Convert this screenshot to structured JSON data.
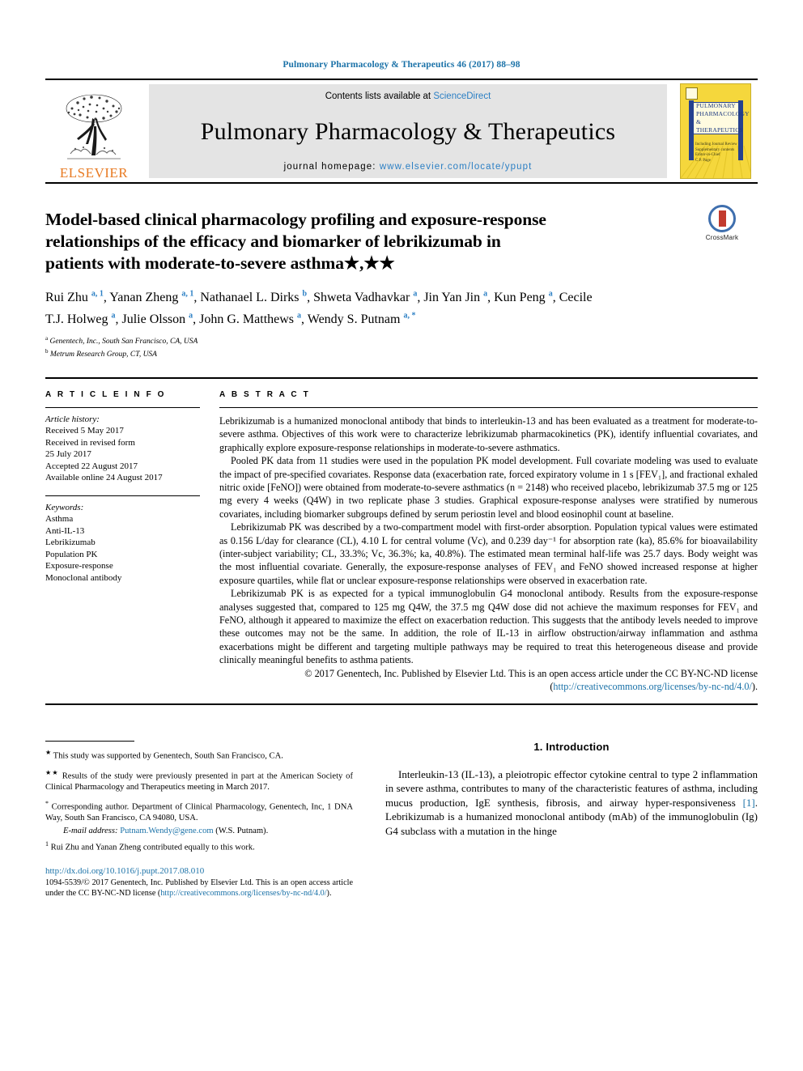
{
  "running_head": "Pulmonary Pharmacology & Therapeutics 46 (2017) 88–98",
  "masthead": {
    "contents_prefix": "Contents lists available at ",
    "sciencedirect": "ScienceDirect",
    "journal_name": "Pulmonary Pharmacology & Therapeutics",
    "homepage_prefix": "journal homepage: ",
    "homepage_url": "www.elsevier.com/locate/ypupt",
    "publisher": "ELSEVIER",
    "cover_title_lines": [
      "PULMONARY",
      "PHARMACOLOGY",
      "& THERAPEUTICS"
    ],
    "cover_sub_lines": [
      "Including Journal Review",
      "Supplementary contents",
      "Editor-in-Chief",
      "C.P. Page"
    ]
  },
  "article": {
    "title": "Model-based clinical pharmacology profiling and exposure-response relationships of the efficacy and biomarker of lebrikizumab in patients with moderate-to-severe asthma★,★★",
    "crossmark_label": "CrossMark",
    "authors": [
      {
        "name": "Rui Zhu",
        "marks": "a, 1"
      },
      {
        "name": "Yanan Zheng",
        "marks": "a, 1"
      },
      {
        "name": "Nathanael L. Dirks",
        "marks": "b"
      },
      {
        "name": "Shweta Vadhavkar",
        "marks": "a"
      },
      {
        "name": "Jin Yan Jin",
        "marks": "a"
      },
      {
        "name": "Kun Peng",
        "marks": "a"
      },
      {
        "name": "Cecile T.J. Holweg",
        "marks": "a"
      },
      {
        "name": "Julie Olsson",
        "marks": "a"
      },
      {
        "name": "John G. Matthews",
        "marks": "a"
      },
      {
        "name": "Wendy S. Putnam",
        "marks": "a, *"
      }
    ],
    "affiliations": [
      {
        "mark": "a",
        "text": "Genentech, Inc., South San Francisco, CA, USA"
      },
      {
        "mark": "b",
        "text": "Metrum Research Group, CT, USA"
      }
    ]
  },
  "article_info": {
    "heading": "A R T I C L E  I N F O",
    "history_label": "Article history:",
    "history": [
      "Received 5 May 2017",
      "Received in revised form",
      "25 July 2017",
      "Accepted 22 August 2017",
      "Available online 24 August 2017"
    ],
    "keywords_label": "Keywords:",
    "keywords": [
      "Asthma",
      "Anti-IL-13",
      "Lebrikizumab",
      "Population PK",
      "Exposure-response",
      "Monoclonal antibody"
    ]
  },
  "abstract": {
    "heading": "A B S T R A C T",
    "paragraphs": [
      "Lebrikizumab is a humanized monoclonal antibody that binds to interleukin-13 and has been evaluated as a treatment for moderate-to-severe asthma. Objectives of this work were to characterize lebrikizumab pharmacokinetics (PK), identify influential covariates, and graphically explore exposure-response relationships in moderate-to-severe asthmatics.",
      "Pooled PK data from 11 studies were used in the population PK model development. Full covariate modeling was used to evaluate the impact of pre-specified covariates. Response data (exacerbation rate, forced expiratory volume in 1 s [FEV₁], and fractional exhaled nitric oxide [FeNO]) were obtained from moderate-to-severe asthmatics (n = 2148) who received placebo, lebrikizumab 37.5 mg or 125 mg every 4 weeks (Q4W) in two replicate phase 3 studies. Graphical exposure-response analyses were stratified by numerous covariates, including biomarker subgroups defined by serum periostin level and blood eosinophil count at baseline.",
      "Lebrikizumab PK was described by a two-compartment model with first-order absorption. Population typical values were estimated as 0.156 L/day for clearance (CL), 4.10 L for central volume (Vc), and 0.239 day⁻¹ for absorption rate (ka), 85.6% for bioavailability (inter-subject variability; CL, 33.3%; Vc, 36.3%; ka, 40.8%). The estimated mean terminal half-life was 25.7 days. Body weight was the most influential covariate. Generally, the exposure-response analyses of FEV₁ and FeNO showed increased response at higher exposure quartiles, while flat or unclear exposure-response relationships were observed in exacerbation rate.",
      "Lebrikizumab PK is as expected for a typical immunoglobulin G4 monoclonal antibody. Results from the exposure-response analyses suggested that, compared to 125 mg Q4W, the 37.5 mg Q4W dose did not achieve the maximum responses for FEV₁ and FeNO, although it appeared to maximize the effect on exacerbation reduction. This suggests that the antibody levels needed to improve these outcomes may not be the same. In addition, the role of IL-13 in airflow obstruction/airway inflammation and asthma exacerbations might be different and targeting multiple pathways may be required to treat this heterogeneous disease and provide clinically meaningful benefits to asthma patients."
    ],
    "copyright_text": "© 2017 Genentech, Inc. Published by Elsevier Ltd. This is an open access article under the CC BY-NC-ND license (",
    "copyright_link": "http://creativecommons.org/licenses/by-nc-nd/4.0/",
    "copyright_tail": ")."
  },
  "footnotes": {
    "star": "This study was supported by Genentech, South San Francisco, CA.",
    "star_mark": "★",
    "dstar_mark": "★★",
    "dstar": "Results of the study were previously presented in part at the American Society of Clinical Pharmacology and Therapeutics meeting in March 2017.",
    "corr_mark": "*",
    "corr": "Corresponding author. Department of Clinical Pharmacology, Genentech, Inc, 1 DNA Way, South San Francisco, CA 94080, USA.",
    "email_label": "E-mail address:",
    "email": "Putnam.Wendy@gene.com",
    "email_tail": "(W.S. Putnam).",
    "one_mark": "1",
    "equal_contrib": "Rui Zhu and Yanan Zheng contributed equally to this work."
  },
  "publication": {
    "doi": "http://dx.doi.org/10.1016/j.pupt.2017.08.010",
    "issn_line_prefix": "1094-5539/© 2017 Genentech, Inc. Published by Elsevier Ltd. This is an open access article under the CC BY-NC-ND license (",
    "issn_link": "http://creativecommons.org/licenses/by-nc-nd/4.0/",
    "issn_tail": ")."
  },
  "introduction": {
    "heading": "1. Introduction",
    "paragraph_pre": "Interleukin-13 (IL-13), a pleiotropic effector cytokine central to type 2 inflammation in severe asthma, contributes to many of the characteristic features of asthma, including mucus production, IgE synthesis, fibrosis, and airway hyper-responsiveness ",
    "ref": "[1]",
    "paragraph_post": ". Lebrikizumab is a humanized monoclonal antibody (mAb) of the immunoglobulin (Ig) G4 subclass with a mutation in the hinge"
  },
  "colors": {
    "link": "#1b72a8",
    "elsevier_orange": "#e87a22",
    "cover_yellow": "#f5d73c",
    "cover_blue": "#25418f"
  }
}
